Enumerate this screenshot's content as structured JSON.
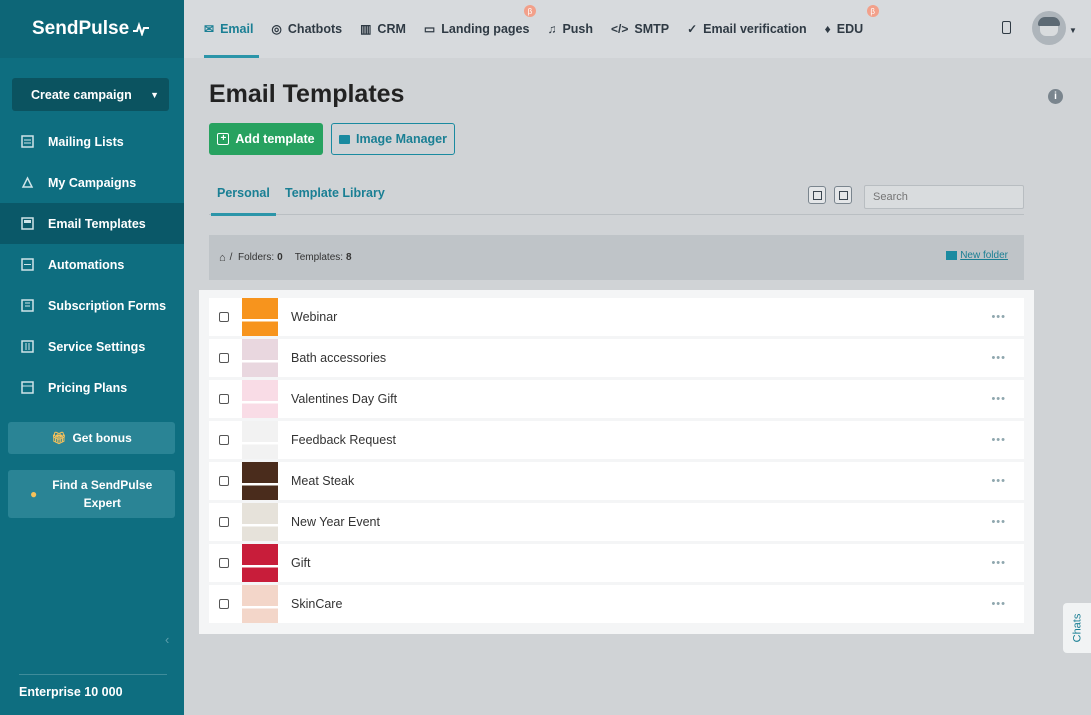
{
  "brand": "SendPulse",
  "sidebar": {
    "create_label": "Create campaign",
    "items": [
      {
        "label": "Mailing Lists",
        "icon": "list-icon"
      },
      {
        "label": "My Campaigns",
        "icon": "campaign-icon"
      },
      {
        "label": "Email Templates",
        "icon": "template-icon",
        "active": true
      },
      {
        "label": "Automations",
        "icon": "automation-icon"
      },
      {
        "label": "Subscription Forms",
        "icon": "form-icon"
      },
      {
        "label": "Service Settings",
        "icon": "settings-icon"
      },
      {
        "label": "Pricing Plans",
        "icon": "pricing-icon"
      }
    ],
    "bonus_label": "Get bonus",
    "expert_label": "Find a SendPulse Expert",
    "plan_label": "Enterprise 10 000"
  },
  "topnav": {
    "items": [
      {
        "label": "Email",
        "icon": "email-icon",
        "active": true
      },
      {
        "label": "Chatbots",
        "icon": "chatbot-icon"
      },
      {
        "label": "CRM",
        "icon": "crm-icon"
      },
      {
        "label": "Landing pages",
        "icon": "landing-icon",
        "beta": true
      },
      {
        "label": "Push",
        "icon": "bell-icon"
      },
      {
        "label": "SMTP",
        "icon": "code-icon"
      },
      {
        "label": "Email verification",
        "icon": "check-icon"
      },
      {
        "label": "EDU",
        "icon": "cap-icon",
        "beta": true
      }
    ],
    "beta_mark": "β"
  },
  "main": {
    "title": "Email Templates",
    "add_template_label": "Add template",
    "image_manager_label": "Image Manager",
    "tabs": [
      "Personal",
      "Template Library"
    ],
    "search_placeholder": "Search",
    "breadcrumb": {
      "folders_label": "Folders:",
      "folders_count": "0",
      "templates_label": "Templates:",
      "templates_count": "8"
    },
    "new_folder_label": "New folder"
  },
  "templates": [
    {
      "name": "Webinar",
      "thumb": "#f7941d"
    },
    {
      "name": "Bath accessories",
      "thumb": "#e9d7df"
    },
    {
      "name": "Valentines Day Gift",
      "thumb": "#f9dce6"
    },
    {
      "name": "Feedback Request",
      "thumb": "#f2f2f2"
    },
    {
      "name": "Meat Steak",
      "thumb": "#4a2c1c"
    },
    {
      "name": "New Year Event",
      "thumb": "#e6e2da"
    },
    {
      "name": "Gift",
      "thumb": "#c81d3a"
    },
    {
      "name": "SkinCare",
      "thumb": "#f3d6c9"
    }
  ],
  "more_label": "•••",
  "chats_label": "Chats"
}
